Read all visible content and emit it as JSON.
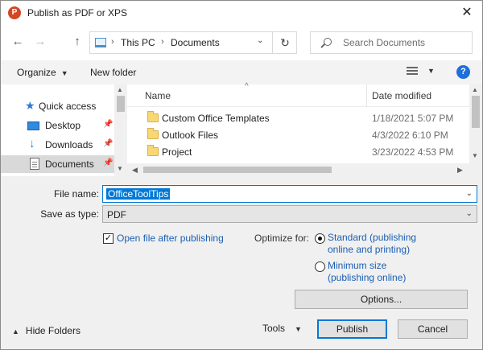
{
  "window": {
    "title": "Publish as PDF or XPS",
    "app_icon": "P",
    "close_glyph": "✕"
  },
  "nav": {
    "back_glyph": "←",
    "forward_glyph": "→",
    "up_glyph": "↑",
    "breadcrumb": [
      "This PC",
      "Documents"
    ],
    "breadcrumb_sep": "›",
    "dropdown_glyph": "⌄",
    "refresh_glyph": "↻",
    "search_placeholder": "Search Documents"
  },
  "toolbar": {
    "organize_label": "Organize",
    "new_folder_label": "New folder",
    "help_glyph": "?"
  },
  "sidebar": {
    "items": [
      {
        "label": "Quick access",
        "icon": "star-icon",
        "pinned": false,
        "selected": false
      },
      {
        "label": "Desktop",
        "icon": "desktop-icon",
        "pinned": true,
        "selected": false
      },
      {
        "label": "Downloads",
        "icon": "download-icon",
        "pinned": true,
        "selected": false
      },
      {
        "label": "Documents",
        "icon": "documents-icon",
        "pinned": true,
        "selected": true
      }
    ]
  },
  "file_list": {
    "columns": {
      "name": "Name",
      "date": "Date modified"
    },
    "rows": [
      {
        "name": "Custom Office Templates",
        "date": "1/18/2021 5:07 PM",
        "icon": "folder-icon"
      },
      {
        "name": "Outlook Files",
        "date": "4/3/2022 6:10 PM",
        "icon": "folder-icon"
      },
      {
        "name": "Project",
        "date": "3/23/2022 4:53 PM",
        "icon": "folder-icon"
      }
    ]
  },
  "form": {
    "file_name_label": "File name:",
    "file_name_value": "OfficeToolTips",
    "save_type_label": "Save as type:",
    "save_type_value": "PDF",
    "open_after_label": "Open file after publishing",
    "open_after_checked": true,
    "optimize_label": "Optimize for:",
    "standard_line1": "Standard (publishing",
    "standard_line2": "online and printing)",
    "minimum_line1": "Minimum size",
    "minimum_line2": "(publishing online)",
    "selected_optimization": "standard",
    "options_label": "Options..."
  },
  "footer": {
    "hide_folders_label": "Hide Folders",
    "tools_label": "Tools",
    "publish_label": "Publish",
    "cancel_label": "Cancel"
  },
  "colors": {
    "accent": "#0078d7",
    "link": "#1a5fb4",
    "folder": "#f8d775"
  }
}
